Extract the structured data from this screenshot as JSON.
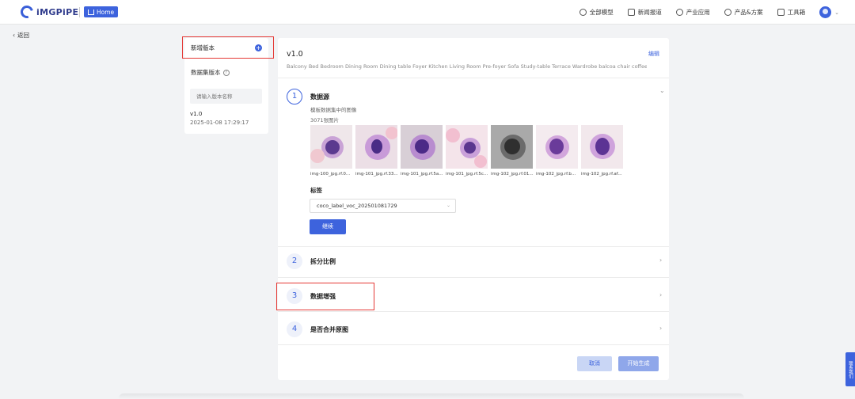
{
  "header": {
    "logo_text": "iMGPiPE",
    "home_label": "Home",
    "nav": [
      "全部模型",
      "新闻报道",
      "产业应用",
      "产品&方案",
      "工具箱"
    ]
  },
  "back_label": "返回",
  "sidebar": {
    "new_version_label": "新增版本",
    "dataset_version_label": "数据集版本",
    "version_input_placeholder": "请输入版本名称",
    "versions": [
      {
        "name": "v1.0",
        "date": "2025-01-08 17:29:17"
      }
    ]
  },
  "main": {
    "version_title": "v1.0",
    "edit_label": "编辑",
    "classes_text": "Balcony Bed Bedroom Dining Room Dining table Foyer Kitchen Living Room Pre-foyer Sofa Study-table Terrace Wardrobe balcoa chair coffee t",
    "steps": [
      {
        "num": "1",
        "title": "数据源"
      },
      {
        "num": "2",
        "title": "拆分比例"
      },
      {
        "num": "3",
        "title": "数据增强"
      },
      {
        "num": "4",
        "title": "是否合并原图"
      }
    ],
    "source": {
      "description": "模板数据集中的图像",
      "count": "3071张图片",
      "thumbnails": [
        "img-100_jpg.rf.0...",
        "img-101_jpg.rf.33...",
        "img-101_jpg.rf.5a...",
        "img-101_jpg.rf.5c...",
        "img-102_jpg.rf.01...",
        "img-102_jpg.rf.b...",
        "img-102_jpg.rf.af..."
      ],
      "label_title": "标签",
      "label_value": "coco_label_voc_202501081729",
      "continue_label": "继续"
    },
    "cancel_label": "取消",
    "start_label": "开始生成"
  },
  "side_tab": "联系我们",
  "colors": {
    "accent": "#3d63dd",
    "highlight": "#e53935"
  }
}
